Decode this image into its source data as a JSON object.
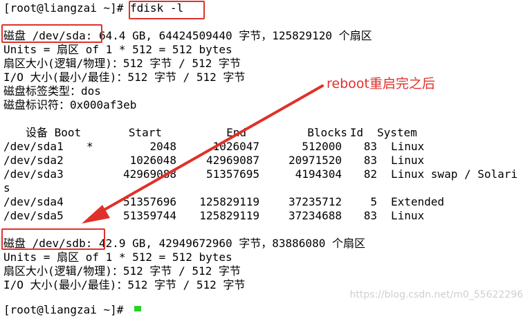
{
  "prompt": {
    "text": "[root@liangzai ~]# ",
    "command": "fdisk -l"
  },
  "disk1": {
    "summary_label": "磁盘 /dev/sda:",
    "summary_rest": " 64.4 GB, 64424509440 字节，125829120 个扇区",
    "units": "Units = 扇区 of 1 * 512 = 512 bytes",
    "sector_size": "扇区大小(逻辑/物理)：512 字节 / 512 字节",
    "io_size": "I/O 大小(最小/最佳)：512 字节 / 512 字节",
    "label_type": "磁盘标签类型：dos",
    "identifier": "磁盘标识符：0x000af3eb"
  },
  "table": {
    "headers": {
      "device": "设备 Boot",
      "start": "Start",
      "end": "End",
      "blocks": "Blocks",
      "id": "Id",
      "system": "System"
    },
    "rows": [
      {
        "device": "/dev/sda1",
        "boot": "*",
        "start": "2048",
        "end": "1026047",
        "blocks": "512000",
        "id": "83",
        "system": "Linux"
      },
      {
        "device": "/dev/sda2",
        "boot": "",
        "start": "1026048",
        "end": "42969087",
        "blocks": "20971520",
        "id": "83",
        "system": "Linux"
      },
      {
        "device": "/dev/sda3",
        "boot": "",
        "start": "42969088",
        "end": "51357695",
        "blocks": "4194304",
        "id": "82",
        "system": "Linux swap / Solari"
      },
      {
        "device": "/dev/sda4",
        "boot": "",
        "start": "51357696",
        "end": "125829119",
        "blocks": "37235712",
        "id": "5",
        "system": "Extended"
      },
      {
        "device": "/dev/sda5",
        "boot": "",
        "start": "51359744",
        "end": "125829119",
        "blocks": "37234688",
        "id": "83",
        "system": "Linux"
      }
    ],
    "wrap": "s"
  },
  "disk2": {
    "summary_label": "磁盘 /dev/sdb:",
    "summary_rest": " 42.9 GB, 42949672960 字节，83886080 个扇区",
    "units": "Units = 扇区 of 1 * 512 = 512 bytes",
    "sector_size": "扇区大小(逻辑/物理)：512 字节 / 512 字节",
    "io_size": "I/O 大小(最小/最佳)：512 字节 / 512 字节"
  },
  "final_prompt": "[root@liangzai ~]# ",
  "annotation": "reboot重启完之后",
  "watermark": "https://blog.csdn.net/m0_55622296",
  "colors": {
    "highlight": "#e0302a",
    "cursor": "#2ad12a"
  }
}
